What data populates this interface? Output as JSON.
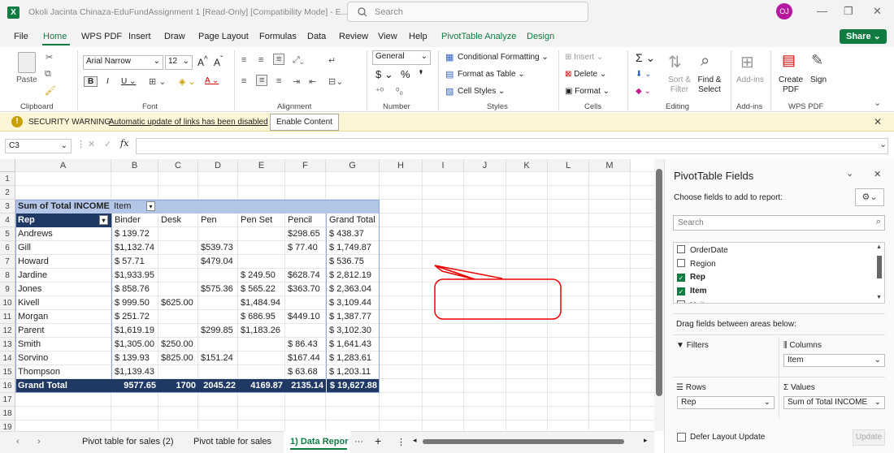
{
  "app": {
    "title": "Okoli Jacinta Chinaza-EduFundAssignment 1  [Read-Only]  [Compatibility Mode]  - E...",
    "search_placeholder": "Search",
    "avatar": "OJ",
    "share": "Share"
  },
  "menu": [
    "File",
    "Home",
    "WPS PDF",
    "Insert",
    "Draw",
    "Page Layout",
    "Formulas",
    "Data",
    "Review",
    "View",
    "Help",
    "PivotTable Analyze",
    "Design"
  ],
  "ribbon": {
    "clipboard": {
      "label": "Clipboard",
      "paste": "Paste"
    },
    "font": {
      "label": "Font",
      "name": "Arial Narrow",
      "size": "12"
    },
    "alignment": {
      "label": "Alignment"
    },
    "number": {
      "label": "Number",
      "format": "General"
    },
    "styles": {
      "label": "Styles",
      "conditional": "Conditional Formatting",
      "format_table": "Format as Table",
      "cell_styles": "Cell Styles"
    },
    "cells": {
      "label": "Cells",
      "insert": "Insert",
      "delete": "Delete",
      "format": "Format"
    },
    "editing": {
      "label": "Editing",
      "sort": "Sort & Filter",
      "find": "Find & Select"
    },
    "addins": {
      "label": "Add-ins",
      "addins": "Add-ins"
    },
    "wps": {
      "label": "WPS PDF",
      "create": "Create PDF",
      "sign": "Sign"
    }
  },
  "warning": {
    "title": "SECURITY WARNING",
    "message": "Automatic update of links has been disabled",
    "button": "Enable Content"
  },
  "formula": {
    "name_box": "C3",
    "fx": "fx",
    "value": ""
  },
  "columns": [
    "A",
    "B",
    "C",
    "D",
    "E",
    "F",
    "G",
    "H",
    "I",
    "J",
    "K",
    "L",
    "M"
  ],
  "rows": [
    "1",
    "2",
    "3",
    "4",
    "5",
    "6",
    "7",
    "8",
    "9",
    "10",
    "11",
    "12",
    "13",
    "14",
    "15",
    "16",
    "17",
    "18",
    "19"
  ],
  "pivot": {
    "corner": "Sum of Total INCOME",
    "col_field": "Item",
    "row_field": "Rep",
    "headers": [
      "Binder",
      "Desk",
      "Pen",
      "Pen Set",
      "Pencil",
      "Grand Total"
    ],
    "data": [
      [
        "Andrews",
        "$    139.72",
        "",
        "",
        "",
        "$298.65",
        "$       438.37"
      ],
      [
        "Gill",
        "$1,132.74",
        "",
        "$539.73",
        "",
        "$  77.40",
        "$    1,749.87"
      ],
      [
        "Howard",
        "$      57.71",
        "",
        "$479.04",
        "",
        "",
        "$       536.75"
      ],
      [
        "Jardine",
        "$1,933.95",
        "",
        "",
        "$    249.50",
        "$628.74",
        "$    2,812.19"
      ],
      [
        "Jones",
        "$    858.76",
        "",
        "$575.36",
        "$    565.22",
        "$363.70",
        "$    2,363.04"
      ],
      [
        "Kivell",
        "$    999.50",
        "$625.00",
        "",
        "$1,484.94",
        "",
        "$    3,109.44"
      ],
      [
        "Morgan",
        "$    251.72",
        "",
        "",
        "$    686.95",
        "$449.10",
        "$    1,387.77"
      ],
      [
        "Parent",
        "$1,619.19",
        "",
        "$299.85",
        "$1,183.26",
        "",
        "$    3,102.30"
      ],
      [
        "Smith",
        "$1,305.00",
        "$250.00",
        "",
        "",
        "$  86.43",
        "$    1,641.43"
      ],
      [
        "Sorvino",
        "$    139.93",
        "$825.00",
        "$151.24",
        "",
        "$167.44",
        "$    1,283.61"
      ],
      [
        "Thompson",
        "$1,139.43",
        "",
        "",
        "",
        "$  63.68",
        "$    1,203.11"
      ]
    ],
    "total": [
      "Grand Total",
      "9577.65",
      "1700",
      "2045.22",
      "4169.87",
      "2135.14",
      "$ 19,627.88"
    ]
  },
  "sheet_tabs": [
    "Pivot table for sales (2)",
    "Pivot table for sales",
    "1) Data Repor"
  ],
  "panel": {
    "title": "PivotTable Fields",
    "choose": "Choose fields to add to report:",
    "search": "Search",
    "fields": [
      {
        "name": "OrderDate",
        "checked": false
      },
      {
        "name": "Region",
        "checked": false
      },
      {
        "name": "Rep",
        "checked": true
      },
      {
        "name": "Item",
        "checked": true
      },
      {
        "name": "Units",
        "checked": false
      }
    ],
    "drag": "Drag fields between areas below:",
    "filters": "Filters",
    "columns": "Columns",
    "rows": "Rows",
    "values": "Values",
    "columns_item": "Item",
    "rows_item": "Rep",
    "values_item": "Sum of Total INCOME",
    "defer": "Defer Layout Update",
    "update": "Update"
  }
}
